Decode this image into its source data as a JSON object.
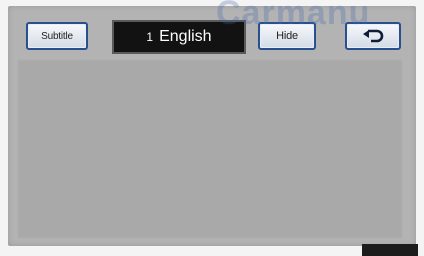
{
  "header": {
    "subtitle_button_label": "Subtitle",
    "language_number": "1",
    "language_name": "English",
    "hide_button_label": "Hide",
    "back_icon": "return-arrow-icon"
  },
  "watermark_text": "Carmanu"
}
